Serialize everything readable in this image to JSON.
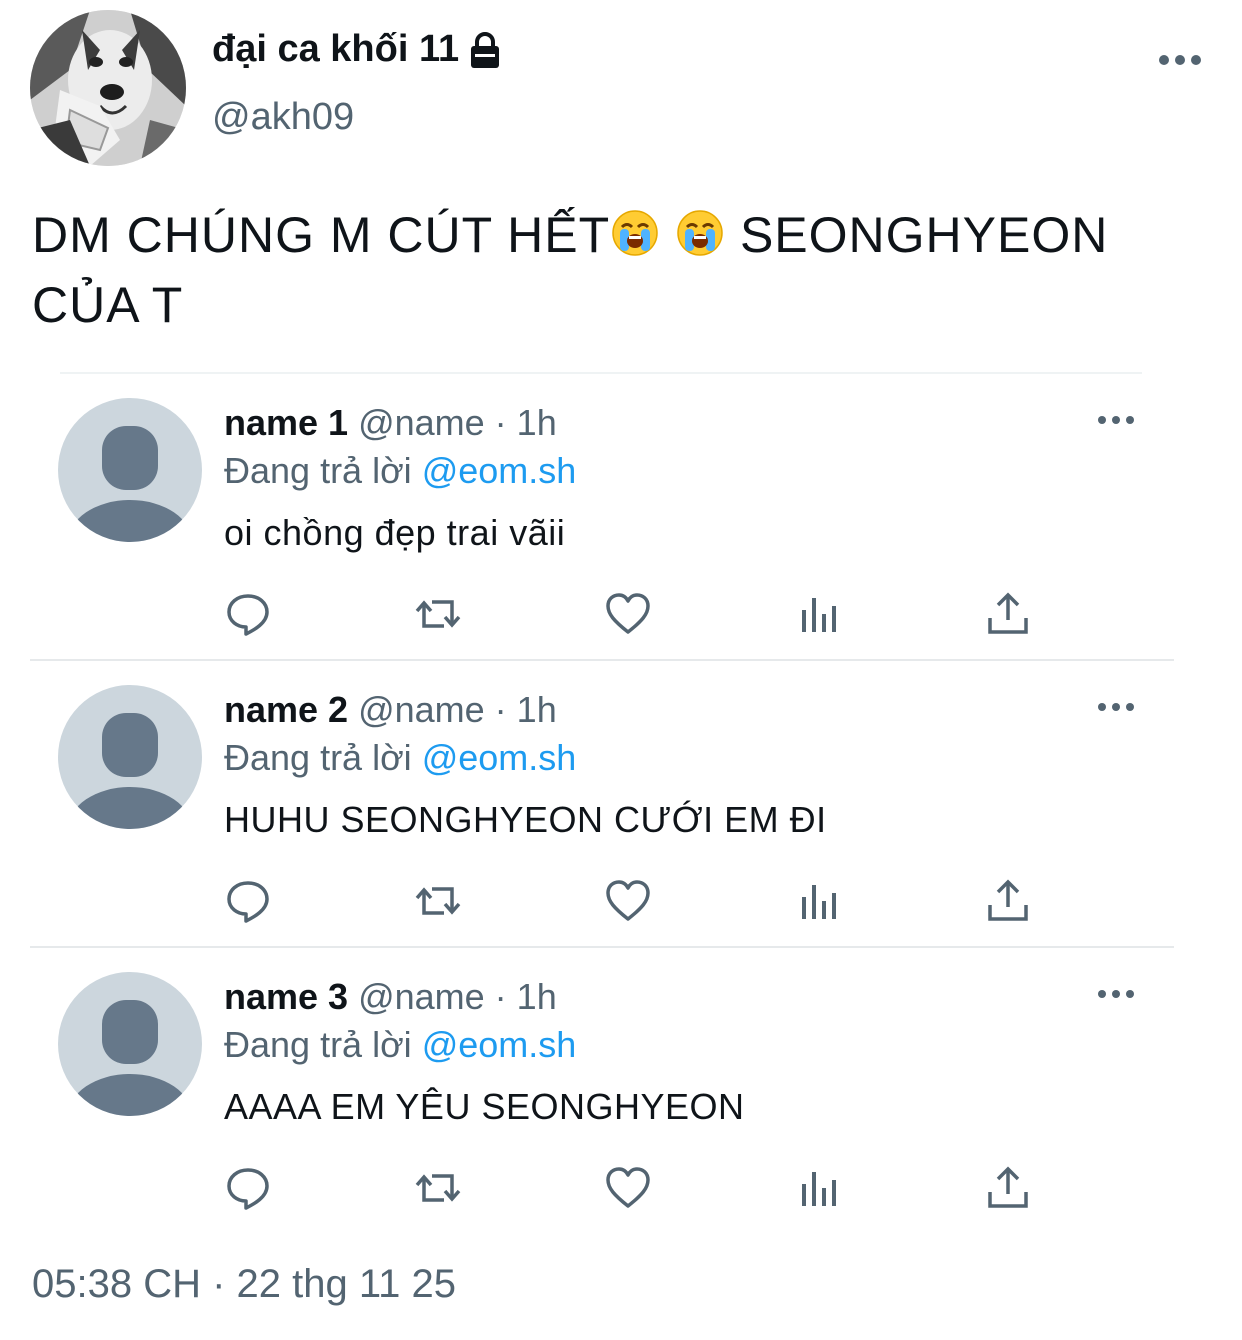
{
  "author": {
    "display_name": "đại ca khối 11",
    "handle": "@akh09",
    "avatar_icon": "husky-dog-avatar",
    "lock_icon": "lock-icon"
  },
  "tweet": {
    "text_part1": "DM CHÚNG M CÚT HẾT",
    "emoji": "loudly-crying-face",
    "text_part2": " SEONGHYEON CỦA T"
  },
  "replies": [
    {
      "name": "name 1",
      "meta": " @name · 1h",
      "replying_label": "Đang trả lời ",
      "mention": "@eom.sh",
      "text": "oi chồng đẹp trai vãii"
    },
    {
      "name": "name 2",
      "meta": " @name · 1h",
      "replying_label": "Đang trả lời ",
      "mention": "@eom.sh",
      "text": "HUHU SEONGHYEON CƯỚI EM ĐI"
    },
    {
      "name": "name 3",
      "meta": " @name · 1h",
      "replying_label": "Đang trả lời ",
      "mention": "@eom.sh",
      "text": "AAAA EM YÊU SEONGHYEON"
    }
  ],
  "timestamp": "05:38 CH · 22 thg 11 25",
  "colors": {
    "text": "#0f1419",
    "secondary": "#536471",
    "link": "#1d9bf0",
    "default_avatar_bg": "#ccd6dd",
    "default_avatar_fg": "#66788a"
  }
}
